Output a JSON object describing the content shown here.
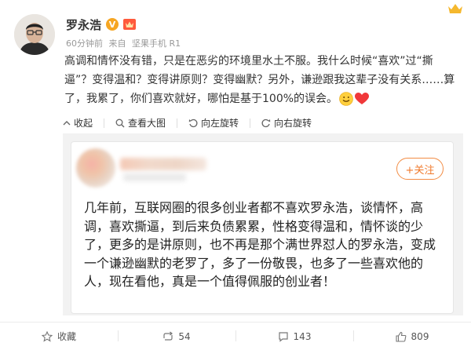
{
  "post": {
    "author": "罗永浩",
    "badge_v": "V",
    "meta": {
      "time": "60分钟前",
      "source_prefix": "来自",
      "source": "坚果手机 R1"
    },
    "text": "高调和情怀没有错，只是在恶劣的环境里水土不服。我什么时候“喜欢”过“撕逼”？变得温和？变得讲原则？变得幽默？另外，谦逊跟我这辈子没有关系……算了，我累了，你们喜欢就好，哪怕是基于100%的误会。"
  },
  "toolbar": {
    "collapse": "收起",
    "view_large": "查看大图",
    "rotate_left": "向左旋转",
    "rotate_right": "向右旋转"
  },
  "card": {
    "follow": "+关注",
    "text": "几年前，互联网圈的很多创业者都不喜欢罗永浩，谈情怀，高调，喜欢撕逼，到后来负债累累，性格变得温和，情怀谈的少了，更多的是讲原则，也不再是那个满世界怼人的罗永浩，变成一个谦逊幽默的老罗了，多了一份敬畏，也多了一些喜欢他的人，现在看他，真是一个值得佩服的创业者！"
  },
  "actions": {
    "favorite": "收藏",
    "repost": "54",
    "comment": "143",
    "like": "809"
  },
  "colors": {
    "accent": "#f07a2c",
    "badge": "#f6a623",
    "crown": "#f5b82e"
  }
}
